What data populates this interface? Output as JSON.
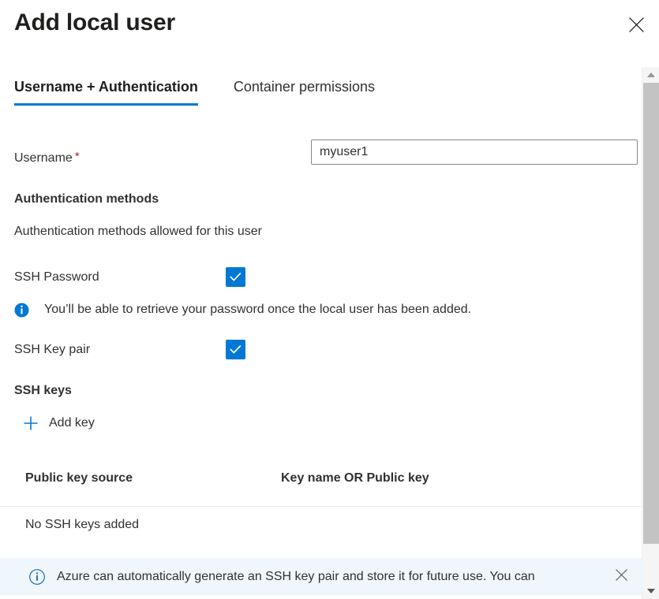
{
  "window": {
    "title": "Add local user",
    "close_label": "Close",
    "close_icon": "close-icon"
  },
  "tabs": [
    {
      "label": "Username + Authentication",
      "active": true
    },
    {
      "label": "Container permissions",
      "active": false
    }
  ],
  "form": {
    "username": {
      "label": "Username",
      "required_marker": "*",
      "value": "myuser1",
      "placeholder": ""
    }
  },
  "auth_methods": {
    "heading": "Authentication methods",
    "description": "Authentication methods allowed for this user",
    "options": [
      {
        "label": "SSH Password",
        "checked": true,
        "check_icon": "check-icon"
      },
      {
        "label": "SSH Key pair",
        "checked": true,
        "check_icon": "check-icon"
      }
    ],
    "info": {
      "icon": "info-circle-filled-icon",
      "text": "You’ll be able to retrieve your password once the local user has been added."
    }
  },
  "ssh_keys": {
    "heading": "SSH keys",
    "add_key": {
      "label": "Add key",
      "icon": "plus-icon"
    },
    "table": {
      "columns": [
        "Public key source",
        "Key name OR Public key"
      ],
      "rows": [],
      "empty_text": "No SSH keys added"
    }
  },
  "banner": {
    "icon": "info-circle-outline-icon",
    "text": "Azure can automatically generate an SSH key pair and store it for future use. You can",
    "close_icon": "close-icon",
    "background": "#eff6fc"
  },
  "scrollbar": {
    "up_icon": "chevron-up-icon",
    "down_icon": "chevron-down-icon",
    "thumb_label": "vertical-scroll-thumb"
  },
  "colors": {
    "accent": "#0078d4",
    "required": "#a4262c",
    "text": "#323130",
    "banner_bg": "#eff6fc",
    "divider": "#edebe9"
  }
}
